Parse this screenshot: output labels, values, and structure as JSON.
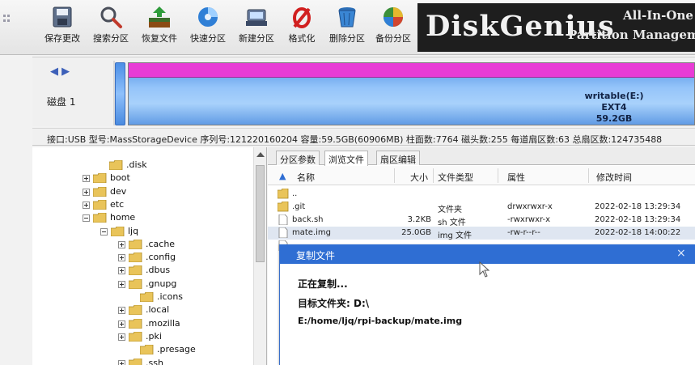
{
  "app": {
    "name": "DiskGenius"
  },
  "toolbar": {
    "buttons": [
      {
        "id": "save",
        "label": "保存更改",
        "icon": "save-icon"
      },
      {
        "id": "search",
        "label": "搜索分区",
        "icon": "search-icon"
      },
      {
        "id": "recover",
        "label": "恢复文件",
        "icon": "recover-files-icon"
      },
      {
        "id": "quick",
        "label": "快速分区",
        "icon": "quick-partition-icon"
      },
      {
        "id": "new",
        "label": "新建分区",
        "icon": "new-partition-icon"
      },
      {
        "id": "format",
        "label": "格式化",
        "icon": "format-icon"
      },
      {
        "id": "delete",
        "label": "删除分区",
        "icon": "delete-partition-icon"
      },
      {
        "id": "backup",
        "label": "备份分区",
        "icon": "backup-partition-icon"
      }
    ],
    "banner": {
      "brand": "DiskGenius",
      "tagline1": "All-In-One",
      "tagline2": "Partition Manageme"
    }
  },
  "disk_map": {
    "disk_label": "磁盘 1",
    "partition": {
      "name": "writable(E:)",
      "fs": "EXT4",
      "size": "59.2GB"
    },
    "colors": {
      "partition_top": "#e83cd6",
      "partition_body": "#94c4fa"
    }
  },
  "disk_info": "接口:USB 型号:MassStorageDevice 序列号:121220160204 容量:59.5GB(60906MB) 柱面数:7764 磁头数:255 每道扇区数:63 总扇区数:124735488",
  "tree": {
    "nodes": [
      {
        "label": ".disk",
        "expander": "none"
      },
      {
        "label": "boot",
        "expander": "plus"
      },
      {
        "label": "dev",
        "expander": "plus"
      },
      {
        "label": "etc",
        "expander": "plus"
      },
      {
        "label": "home",
        "expander": "minus"
      },
      {
        "label": "ljq",
        "expander": "minus"
      },
      {
        "label": ".cache",
        "expander": "plus"
      },
      {
        "label": ".config",
        "expander": "plus"
      },
      {
        "label": ".dbus",
        "expander": "plus"
      },
      {
        "label": ".gnupg",
        "expander": "plus"
      },
      {
        "label": ".icons",
        "expander": "none"
      },
      {
        "label": ".local",
        "expander": "plus"
      },
      {
        "label": ".mozilla",
        "expander": "plus"
      },
      {
        "label": ".pki",
        "expander": "plus"
      },
      {
        "label": ".presage",
        "expander": "none"
      },
      {
        "label": ".ssh",
        "expander": "plus"
      }
    ]
  },
  "tabs": [
    {
      "label": "分区参数",
      "active": false
    },
    {
      "label": "浏览文件",
      "active": true
    },
    {
      "label": "扇区编辑",
      "active": false
    }
  ],
  "file_list": {
    "headers": {
      "name": "名称",
      "size": "大小",
      "type": "文件类型",
      "attr": "属性",
      "mtime": "修改时间"
    },
    "rows": [
      {
        "name": "..",
        "size": "",
        "type": "",
        "attr": "",
        "mtime": "",
        "icon": "folder-up-icon",
        "selected": false
      },
      {
        "name": ".git",
        "size": "",
        "type": "文件夹",
        "attr": "drwxrwxr-x",
        "mtime": "2022-02-18 13:29:34",
        "icon": "folder-icon",
        "selected": false
      },
      {
        "name": "back.sh",
        "size": "3.2KB",
        "type": "sh 文件",
        "attr": "-rwxrwxr-x",
        "mtime": "2022-02-18 13:29:34",
        "icon": "file-icon",
        "selected": false
      },
      {
        "name": "mate.img",
        "size": "25.0GB",
        "type": "img 文件",
        "attr": "-rw-r--r--",
        "mtime": "2022-02-18 14:00:22",
        "icon": "file-icon",
        "selected": true
      },
      {
        "name": "",
        "size": "",
        "type": "",
        "attr": "",
        "mtime": "",
        "icon": "file-icon",
        "selected": false
      }
    ]
  },
  "copy_dialog": {
    "title": "复制文件",
    "status": "正在复制...",
    "target_label": "目标文件夹: D:\\",
    "current_file": "E:/home/ljq/rpi-backup/mate.img",
    "close_glyph": "×"
  }
}
